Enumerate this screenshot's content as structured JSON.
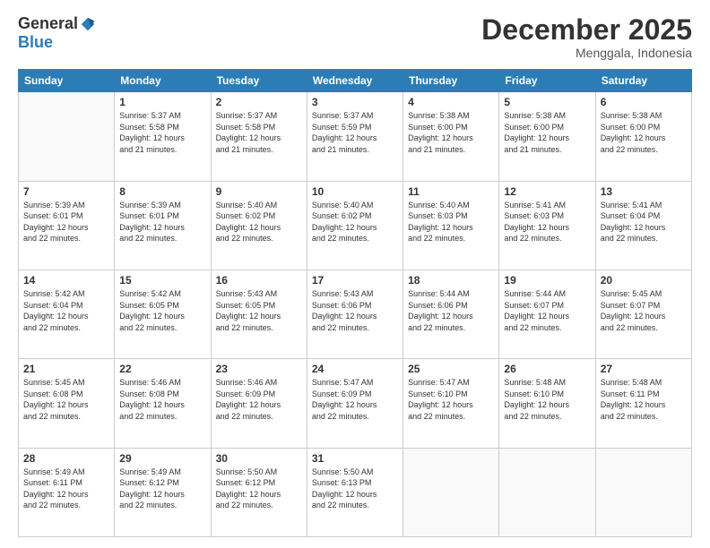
{
  "logo": {
    "general": "General",
    "blue": "Blue"
  },
  "header": {
    "month": "December 2025",
    "location": "Menggala, Indonesia"
  },
  "weekdays": [
    "Sunday",
    "Monday",
    "Tuesday",
    "Wednesday",
    "Thursday",
    "Friday",
    "Saturday"
  ],
  "weeks": [
    [
      {
        "day": "",
        "info": ""
      },
      {
        "day": "1",
        "info": "Sunrise: 5:37 AM\nSunset: 5:58 PM\nDaylight: 12 hours\nand 21 minutes."
      },
      {
        "day": "2",
        "info": "Sunrise: 5:37 AM\nSunset: 5:58 PM\nDaylight: 12 hours\nand 21 minutes."
      },
      {
        "day": "3",
        "info": "Sunrise: 5:37 AM\nSunset: 5:59 PM\nDaylight: 12 hours\nand 21 minutes."
      },
      {
        "day": "4",
        "info": "Sunrise: 5:38 AM\nSunset: 6:00 PM\nDaylight: 12 hours\nand 21 minutes."
      },
      {
        "day": "5",
        "info": "Sunrise: 5:38 AM\nSunset: 6:00 PM\nDaylight: 12 hours\nand 21 minutes."
      },
      {
        "day": "6",
        "info": "Sunrise: 5:38 AM\nSunset: 6:00 PM\nDaylight: 12 hours\nand 22 minutes."
      }
    ],
    [
      {
        "day": "7",
        "info": "Sunrise: 5:39 AM\nSunset: 6:01 PM\nDaylight: 12 hours\nand 22 minutes."
      },
      {
        "day": "8",
        "info": "Sunrise: 5:39 AM\nSunset: 6:01 PM\nDaylight: 12 hours\nand 22 minutes."
      },
      {
        "day": "9",
        "info": "Sunrise: 5:40 AM\nSunset: 6:02 PM\nDaylight: 12 hours\nand 22 minutes."
      },
      {
        "day": "10",
        "info": "Sunrise: 5:40 AM\nSunset: 6:02 PM\nDaylight: 12 hours\nand 22 minutes."
      },
      {
        "day": "11",
        "info": "Sunrise: 5:40 AM\nSunset: 6:03 PM\nDaylight: 12 hours\nand 22 minutes."
      },
      {
        "day": "12",
        "info": "Sunrise: 5:41 AM\nSunset: 6:03 PM\nDaylight: 12 hours\nand 22 minutes."
      },
      {
        "day": "13",
        "info": "Sunrise: 5:41 AM\nSunset: 6:04 PM\nDaylight: 12 hours\nand 22 minutes."
      }
    ],
    [
      {
        "day": "14",
        "info": "Sunrise: 5:42 AM\nSunset: 6:04 PM\nDaylight: 12 hours\nand 22 minutes."
      },
      {
        "day": "15",
        "info": "Sunrise: 5:42 AM\nSunset: 6:05 PM\nDaylight: 12 hours\nand 22 minutes."
      },
      {
        "day": "16",
        "info": "Sunrise: 5:43 AM\nSunset: 6:05 PM\nDaylight: 12 hours\nand 22 minutes."
      },
      {
        "day": "17",
        "info": "Sunrise: 5:43 AM\nSunset: 6:06 PM\nDaylight: 12 hours\nand 22 minutes."
      },
      {
        "day": "18",
        "info": "Sunrise: 5:44 AM\nSunset: 6:06 PM\nDaylight: 12 hours\nand 22 minutes."
      },
      {
        "day": "19",
        "info": "Sunrise: 5:44 AM\nSunset: 6:07 PM\nDaylight: 12 hours\nand 22 minutes."
      },
      {
        "day": "20",
        "info": "Sunrise: 5:45 AM\nSunset: 6:07 PM\nDaylight: 12 hours\nand 22 minutes."
      }
    ],
    [
      {
        "day": "21",
        "info": "Sunrise: 5:45 AM\nSunset: 6:08 PM\nDaylight: 12 hours\nand 22 minutes."
      },
      {
        "day": "22",
        "info": "Sunrise: 5:46 AM\nSunset: 6:08 PM\nDaylight: 12 hours\nand 22 minutes."
      },
      {
        "day": "23",
        "info": "Sunrise: 5:46 AM\nSunset: 6:09 PM\nDaylight: 12 hours\nand 22 minutes."
      },
      {
        "day": "24",
        "info": "Sunrise: 5:47 AM\nSunset: 6:09 PM\nDaylight: 12 hours\nand 22 minutes."
      },
      {
        "day": "25",
        "info": "Sunrise: 5:47 AM\nSunset: 6:10 PM\nDaylight: 12 hours\nand 22 minutes."
      },
      {
        "day": "26",
        "info": "Sunrise: 5:48 AM\nSunset: 6:10 PM\nDaylight: 12 hours\nand 22 minutes."
      },
      {
        "day": "27",
        "info": "Sunrise: 5:48 AM\nSunset: 6:11 PM\nDaylight: 12 hours\nand 22 minutes."
      }
    ],
    [
      {
        "day": "28",
        "info": "Sunrise: 5:49 AM\nSunset: 6:11 PM\nDaylight: 12 hours\nand 22 minutes."
      },
      {
        "day": "29",
        "info": "Sunrise: 5:49 AM\nSunset: 6:12 PM\nDaylight: 12 hours\nand 22 minutes."
      },
      {
        "day": "30",
        "info": "Sunrise: 5:50 AM\nSunset: 6:12 PM\nDaylight: 12 hours\nand 22 minutes."
      },
      {
        "day": "31",
        "info": "Sunrise: 5:50 AM\nSunset: 6:13 PM\nDaylight: 12 hours\nand 22 minutes."
      },
      {
        "day": "",
        "info": ""
      },
      {
        "day": "",
        "info": ""
      },
      {
        "day": "",
        "info": ""
      }
    ]
  ]
}
